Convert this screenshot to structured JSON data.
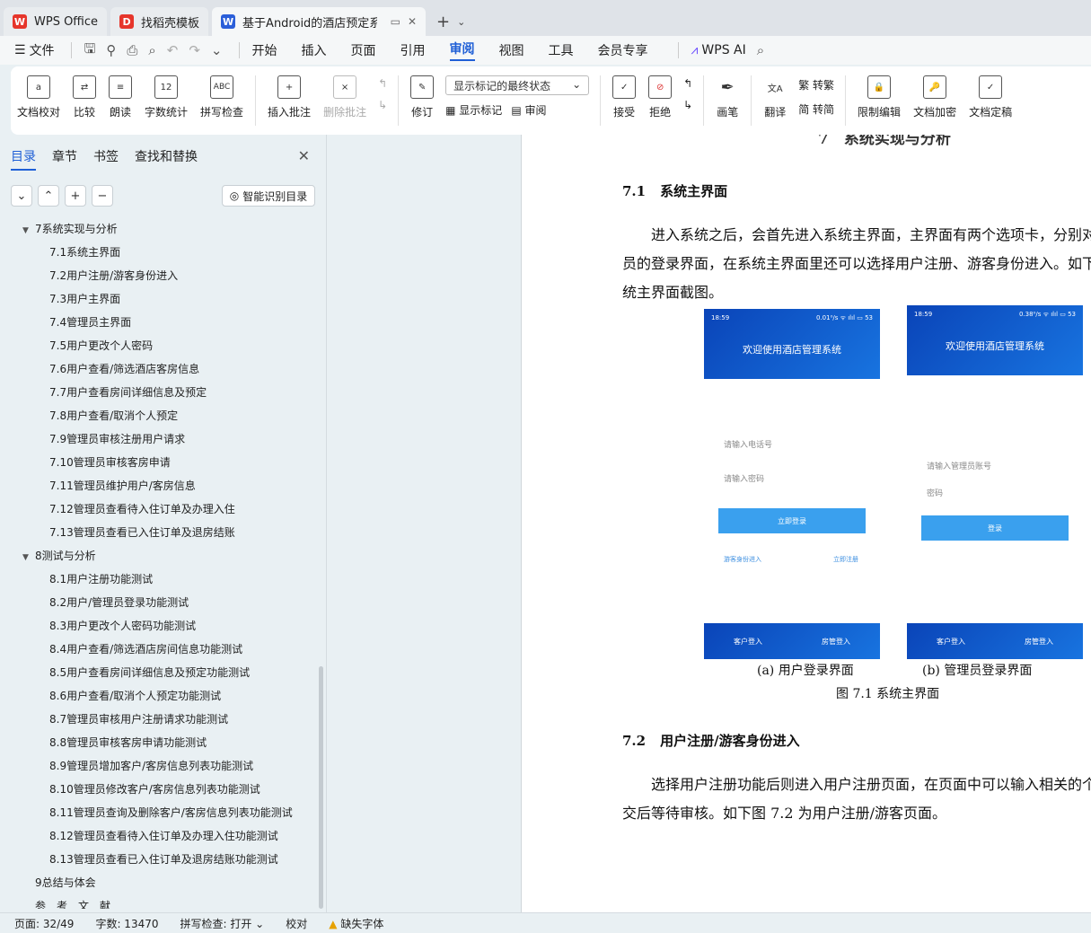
{
  "tabs": [
    {
      "label": "WPS Office",
      "logo": "W",
      "color": "#e6352b"
    },
    {
      "label": "找稻壳模板",
      "logo": "D",
      "color": "#e6352b"
    },
    {
      "label": "基于Android的酒店预定系统",
      "logo": "W",
      "color": "#2b5fd9"
    }
  ],
  "menu": {
    "file": "文件",
    "tabs": [
      "开始",
      "插入",
      "页面",
      "引用",
      "审阅",
      "视图",
      "工具",
      "会员专享"
    ],
    "active": "审阅",
    "ai": "WPS AI"
  },
  "ribbon": {
    "group1": [
      "文档校对",
      "比较",
      "朗读",
      "字数统计",
      "拼写检查"
    ],
    "insert_comment": "插入批注",
    "delete_comment": "删除批注",
    "revise": "修订",
    "markup_state": "显示标记的最终状态",
    "show_markup": "显示标记",
    "review": "审阅",
    "accept": "接受",
    "reject": "拒绝",
    "pen": "画笔",
    "translate": "翻译",
    "trad": "转繁",
    "simp": "转简",
    "restrict": "限制编辑",
    "encrypt": "文档加密",
    "finalize": "文档定稿"
  },
  "panel": {
    "tabs": [
      "目录",
      "章节",
      "书签",
      "查找和替换"
    ],
    "ai_toc": "智能识别目录",
    "toc": [
      {
        "level": 1,
        "text": "7系统实现与分析",
        "arrow": "▼"
      },
      {
        "level": 2,
        "text": "7.1系统主界面"
      },
      {
        "level": 2,
        "text": "7.2用户注册/游客身份进入"
      },
      {
        "level": 2,
        "text": "7.3用户主界面"
      },
      {
        "level": 2,
        "text": "7.4管理员主界面"
      },
      {
        "level": 2,
        "text": "7.5用户更改个人密码"
      },
      {
        "level": 2,
        "text": "7.6用户查看/筛选酒店客房信息"
      },
      {
        "level": 2,
        "text": "7.7用户查看房间详细信息及预定"
      },
      {
        "level": 2,
        "text": "7.8用户查看/取消个人预定"
      },
      {
        "level": 2,
        "text": "7.9管理员审核注册用户请求"
      },
      {
        "level": 2,
        "text": "7.10管理员审核客房申请"
      },
      {
        "level": 2,
        "text": "7.11管理员维护用户/客房信息"
      },
      {
        "level": 2,
        "text": "7.12管理员查看待入住订单及办理入住"
      },
      {
        "level": 2,
        "text": "7.13管理员查看已入住订单及退房结账"
      },
      {
        "level": 1,
        "text": "8测试与分析",
        "arrow": "▼"
      },
      {
        "level": 2,
        "text": "8.1用户注册功能测试"
      },
      {
        "level": 2,
        "text": "8.2用户/管理员登录功能测试"
      },
      {
        "level": 2,
        "text": "8.3用户更改个人密码功能测试"
      },
      {
        "level": 2,
        "text": "8.4用户查看/筛选酒店房间信息功能测试"
      },
      {
        "level": 2,
        "text": "8.5用户查看房间详细信息及预定功能测试"
      },
      {
        "level": 2,
        "text": "8.6用户查看/取消个人预定功能测试"
      },
      {
        "level": 2,
        "text": "8.7管理员审核用户注册请求功能测试"
      },
      {
        "level": 2,
        "text": "8.8管理员审核客房申请功能测试"
      },
      {
        "level": 2,
        "text": "8.9管理员增加客户/客房信息列表功能测试"
      },
      {
        "level": 2,
        "text": "8.10管理员修改客户/客房信息列表功能测试"
      },
      {
        "level": 2,
        "text": "8.11管理员查询及删除客户/客房信息列表功能测试"
      },
      {
        "level": 2,
        "text": "8.12管理员查看待入住订单及办理入住功能测试"
      },
      {
        "level": 2,
        "text": "8.13管理员查看已入住订单及退房结账功能测试"
      },
      {
        "level": 1,
        "text": "9总结与体会"
      },
      {
        "level": 1,
        "text": "参　考　文　献"
      }
    ]
  },
  "doc": {
    "chapter": "7　系统实现与分析",
    "s71_num": "7.1",
    "s71_title": "系统主界面",
    "p1_l1": "进入系统之后，会首先进入系统主界面，主界面有两个选项卡，分别对应",
    "p1_l2": "员的登录界面，在系统主界面里还可以选择用户注册、游客身份进入。如下",
    "p1_l3": "统主界面截图。",
    "phone_a": {
      "time": "18:59",
      "status": "0.01⁰/s ᯤ ılıl ▭ 53",
      "welcome": "欢迎使用酒店管理系统",
      "field1": "请输入电话号",
      "field2": "请输入密码",
      "button": "立即登录",
      "link1": "游客身份进入",
      "link2": "立即注册",
      "tab1": "客户登入",
      "tab2": "房管登入"
    },
    "phone_b": {
      "time": "18:59",
      "status": "0.38⁰/s ᯤ ılıl ▭ 53",
      "welcome": "欢迎使用酒店管理系统",
      "field1": "请输入管理员账号",
      "field2": "密码",
      "button": "登录",
      "tab1": "客户登入",
      "tab2": "房管登入"
    },
    "cap_a": "(a)  用户登录界面",
    "cap_b": "(b)  管理员登录界面",
    "figure": "图 7.1  系统主界面",
    "s72_num": "7.2",
    "s72_title": "用户注册/游客身份进入",
    "p2_l1": "选择用户注册功能后则进入用户注册页面，在页面中可以输入相关的个人",
    "p2_l2": "交后等待审核。如下图 7.2 为用户注册/游客页面。"
  },
  "status": {
    "page": "页面: 32/49",
    "words": "字数: 13470",
    "spell": "拼写检查: 打开",
    "proof": "校对",
    "missing_font": "缺失字体"
  }
}
